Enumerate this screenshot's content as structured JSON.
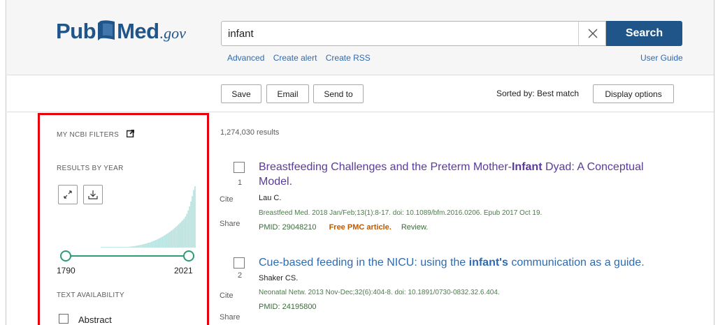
{
  "logo": {
    "pub": "Pub",
    "med": "Med",
    "gov": ".gov"
  },
  "search": {
    "query": "infant",
    "button_label": "Search",
    "links": [
      "Advanced",
      "Create alert",
      "Create RSS"
    ],
    "user_guide": "User Guide"
  },
  "toolbar": {
    "save": "Save",
    "email": "Email",
    "send_to": "Send to",
    "sorted_by": "Sorted by: Best match",
    "display_options": "Display options"
  },
  "filters": {
    "my_ncbi": "MY NCBI FILTERS",
    "results_by_year": "RESULTS BY YEAR",
    "year_start": "1790",
    "year_end": "2021",
    "text_availability": "TEXT AVAILABILITY",
    "abstract": "Abstract"
  },
  "results_count": "1,274,030 results",
  "results": [
    {
      "number": "1",
      "title_before": "Breastfeeding Challenges and the Preterm Mother-",
      "title_highlight": "Infant",
      "title_after": " Dyad: A Conceptual Model.",
      "title_color": "#5a3a9a",
      "authors": "Lau C.",
      "citation": "Breastfeed Med. 2018 Jan/Feb;13(1):8-17. doi: 10.1089/bfm.2016.0206. Epub 2017 Oct 19.",
      "pmid": "PMID: 29048210",
      "free_pmc": "Free PMC article.",
      "article_type": "Review.",
      "cite": "Cite",
      "share": "Share"
    },
    {
      "number": "2",
      "title_before": "Cue-based feeding in the NICU: using the ",
      "title_highlight": "infant's",
      "title_after": " communication as a guide.",
      "title_color": "#2e6ab0",
      "authors": "Shaker CS.",
      "citation": "Neonatal Netw. 2013 Nov-Dec;32(6):404-8. doi: 10.1891/0730-0832.32.6.404.",
      "pmid": "PMID: 24195800",
      "cite": "Cite",
      "share": "Share"
    }
  ],
  "colors": {
    "brand": "#20558a",
    "link": "#2e6ab0",
    "highlight_border": "#e8000b",
    "histogram": "#b9e3e0",
    "slider": "#2d9c72"
  }
}
